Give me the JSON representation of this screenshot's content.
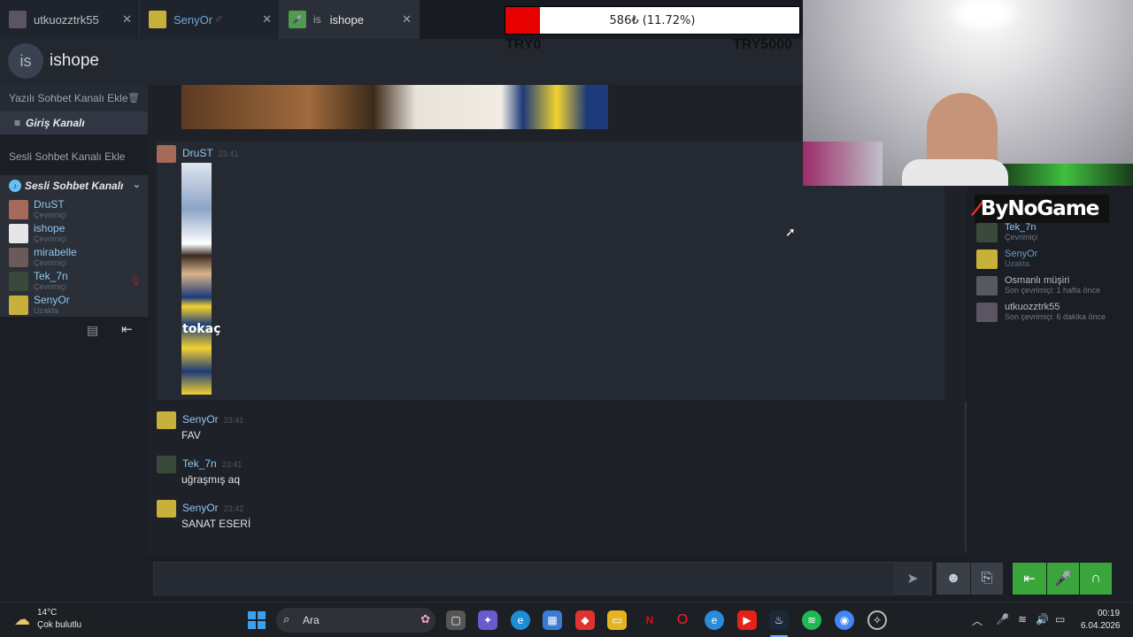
{
  "tabs": [
    {
      "label": "utkuozztrk55",
      "avatar_color": "#5a5560"
    },
    {
      "label": "SenyOr",
      "avatar_color": "#c7b13a"
    },
    {
      "label": "ishope",
      "avatar_text": "is",
      "avatar_color": "#4f9a4f"
    }
  ],
  "donation": {
    "progress_text": "586₺ (11.72%)",
    "progress_fraction": 0.1172,
    "min_label": "TRY0",
    "max_label": "TRY5000"
  },
  "header": {
    "avatar_text": "is",
    "title": "ishope"
  },
  "left": {
    "add_text_channel": "Yazılı Sohbet Kanalı Ekle",
    "welcome_channel": "Giriş Kanalı",
    "add_voice_channel": "Sesli Sohbet Kanalı Ekle",
    "voice_channel": "Sesli Sohbet Kanalı",
    "members": [
      {
        "name": "DruST",
        "status": "Çevrimiçi",
        "color": "#a56a5a"
      },
      {
        "name": "ishope",
        "status": "Çevrimiçi",
        "color": "#e6e6e6"
      },
      {
        "name": "mirabelle",
        "status": "Çevrimiçi",
        "color": "#6a5a5a"
      },
      {
        "name": "Tek_7n",
        "status": "Çevrimiçi",
        "color": "#3a4a3a"
      },
      {
        "name": "SenyOr",
        "status": "Uzakta",
        "color": "#c7b13a"
      }
    ]
  },
  "chat": {
    "messages": [
      {
        "author": "DruST",
        "time": "23:41",
        "text": "",
        "avatar_color": "#a56a5a"
      },
      {
        "author": "SenyOr",
        "time": "23:41",
        "text": "FAV",
        "avatar_color": "#c7b13a"
      },
      {
        "author": "Tek_7n",
        "time": "23:41",
        "text": "uğraşmış aq",
        "avatar_color": "#3a4a3a"
      },
      {
        "author": "SenyOr",
        "time": "23:42",
        "text": "SANAT ESERİ",
        "avatar_color": "#c7b13a"
      }
    ],
    "image_caption": "tokaç",
    "input_value": ""
  },
  "brand": {
    "name": "ByNoGame"
  },
  "friends": [
    {
      "name": "Tek_7n",
      "status": "Çevrimiçi",
      "color": "#3a4a3a"
    },
    {
      "name": "SenyOr",
      "status": "Uzakta",
      "color": "#c7b13a"
    },
    {
      "name": "Osmanlı müşiri",
      "status": "Son çevrimiçi: 1 hafta önce",
      "color": "#555a60"
    },
    {
      "name": "utkuozztrk55",
      "status": "Son çevrimiçi: 6 dakika önce",
      "color": "#5a5560"
    }
  ],
  "taskbar": {
    "weather_temp": "14°C",
    "weather_cond": "Çok bulutlu",
    "search_label": "Ara",
    "time": "00:19",
    "date": "6.04.2026"
  },
  "colors": {
    "accent": "#66c0f4",
    "green": "#3aa53a",
    "bar_red": "#e60000"
  }
}
